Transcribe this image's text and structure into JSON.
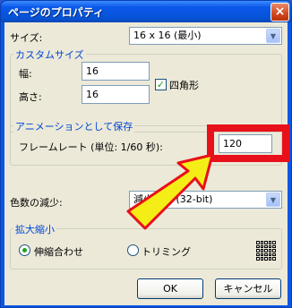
{
  "window": {
    "title": "ページのプロパティ",
    "close_label": "×"
  },
  "size": {
    "label": "サイズ:",
    "selected": "16 x 16 (最小)"
  },
  "custom_size": {
    "group_label": "カスタムサイズ",
    "width_label": "幅:",
    "width_value": "16",
    "height_label": "高さ:",
    "height_value": "16",
    "square_label": "四角形",
    "square_checked": true
  },
  "animation": {
    "group_label": "アニメーションとして保存",
    "frame_rate_label": "フレームレート (単位: 1/60 秒):",
    "frame_rate_value": "120"
  },
  "color_reduction": {
    "label": "色数の減少:",
    "selected": "減少なし (32-bit)"
  },
  "scaling": {
    "group_label": "拡大縮小",
    "fit_label": "伸縮合わせ",
    "fit_selected": true,
    "trim_label": "トリミング",
    "trim_selected": false
  },
  "buttons": {
    "ok": "OK",
    "cancel": "キャンセル"
  },
  "overlay": {
    "highlight_color": "#e8101a",
    "arrow_color": "#f5ee16"
  }
}
